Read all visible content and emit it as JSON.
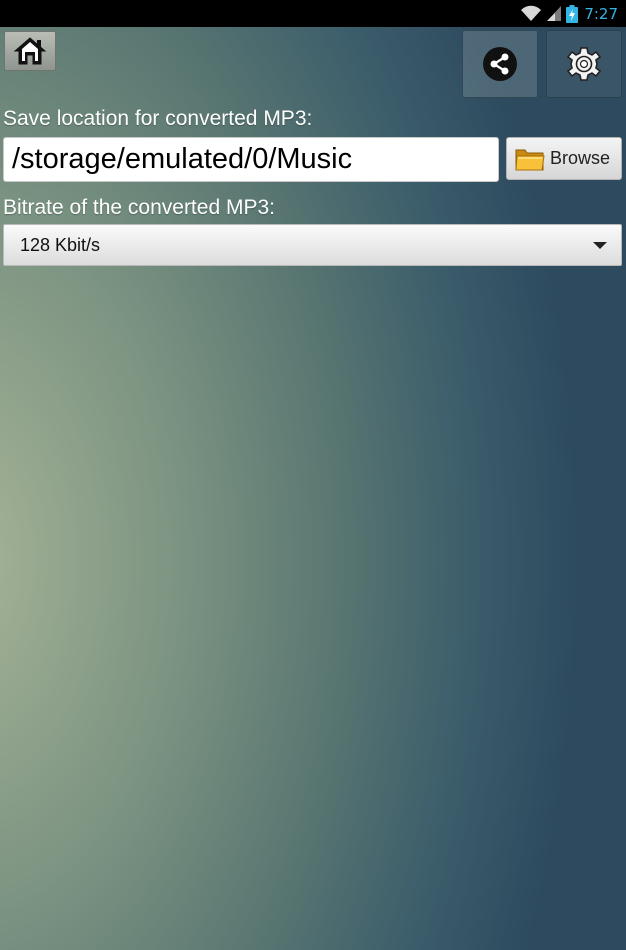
{
  "status_bar": {
    "time": "7:27",
    "icons": [
      "wifi-icon",
      "signal-icon",
      "battery-charging-icon"
    ],
    "time_color": "#33b5e5"
  },
  "toolbar": {
    "home_icon": "home-icon",
    "share_icon": "share-icon",
    "settings_icon": "gear-icon"
  },
  "save_location": {
    "label": "Save location for converted MP3:",
    "value": "/storage/emulated/0/Music",
    "browse_label": "Browse",
    "browse_icon": "folder-icon"
  },
  "bitrate": {
    "label": "Bitrate of the converted MP3:",
    "selected": "128 Kbit/s"
  }
}
